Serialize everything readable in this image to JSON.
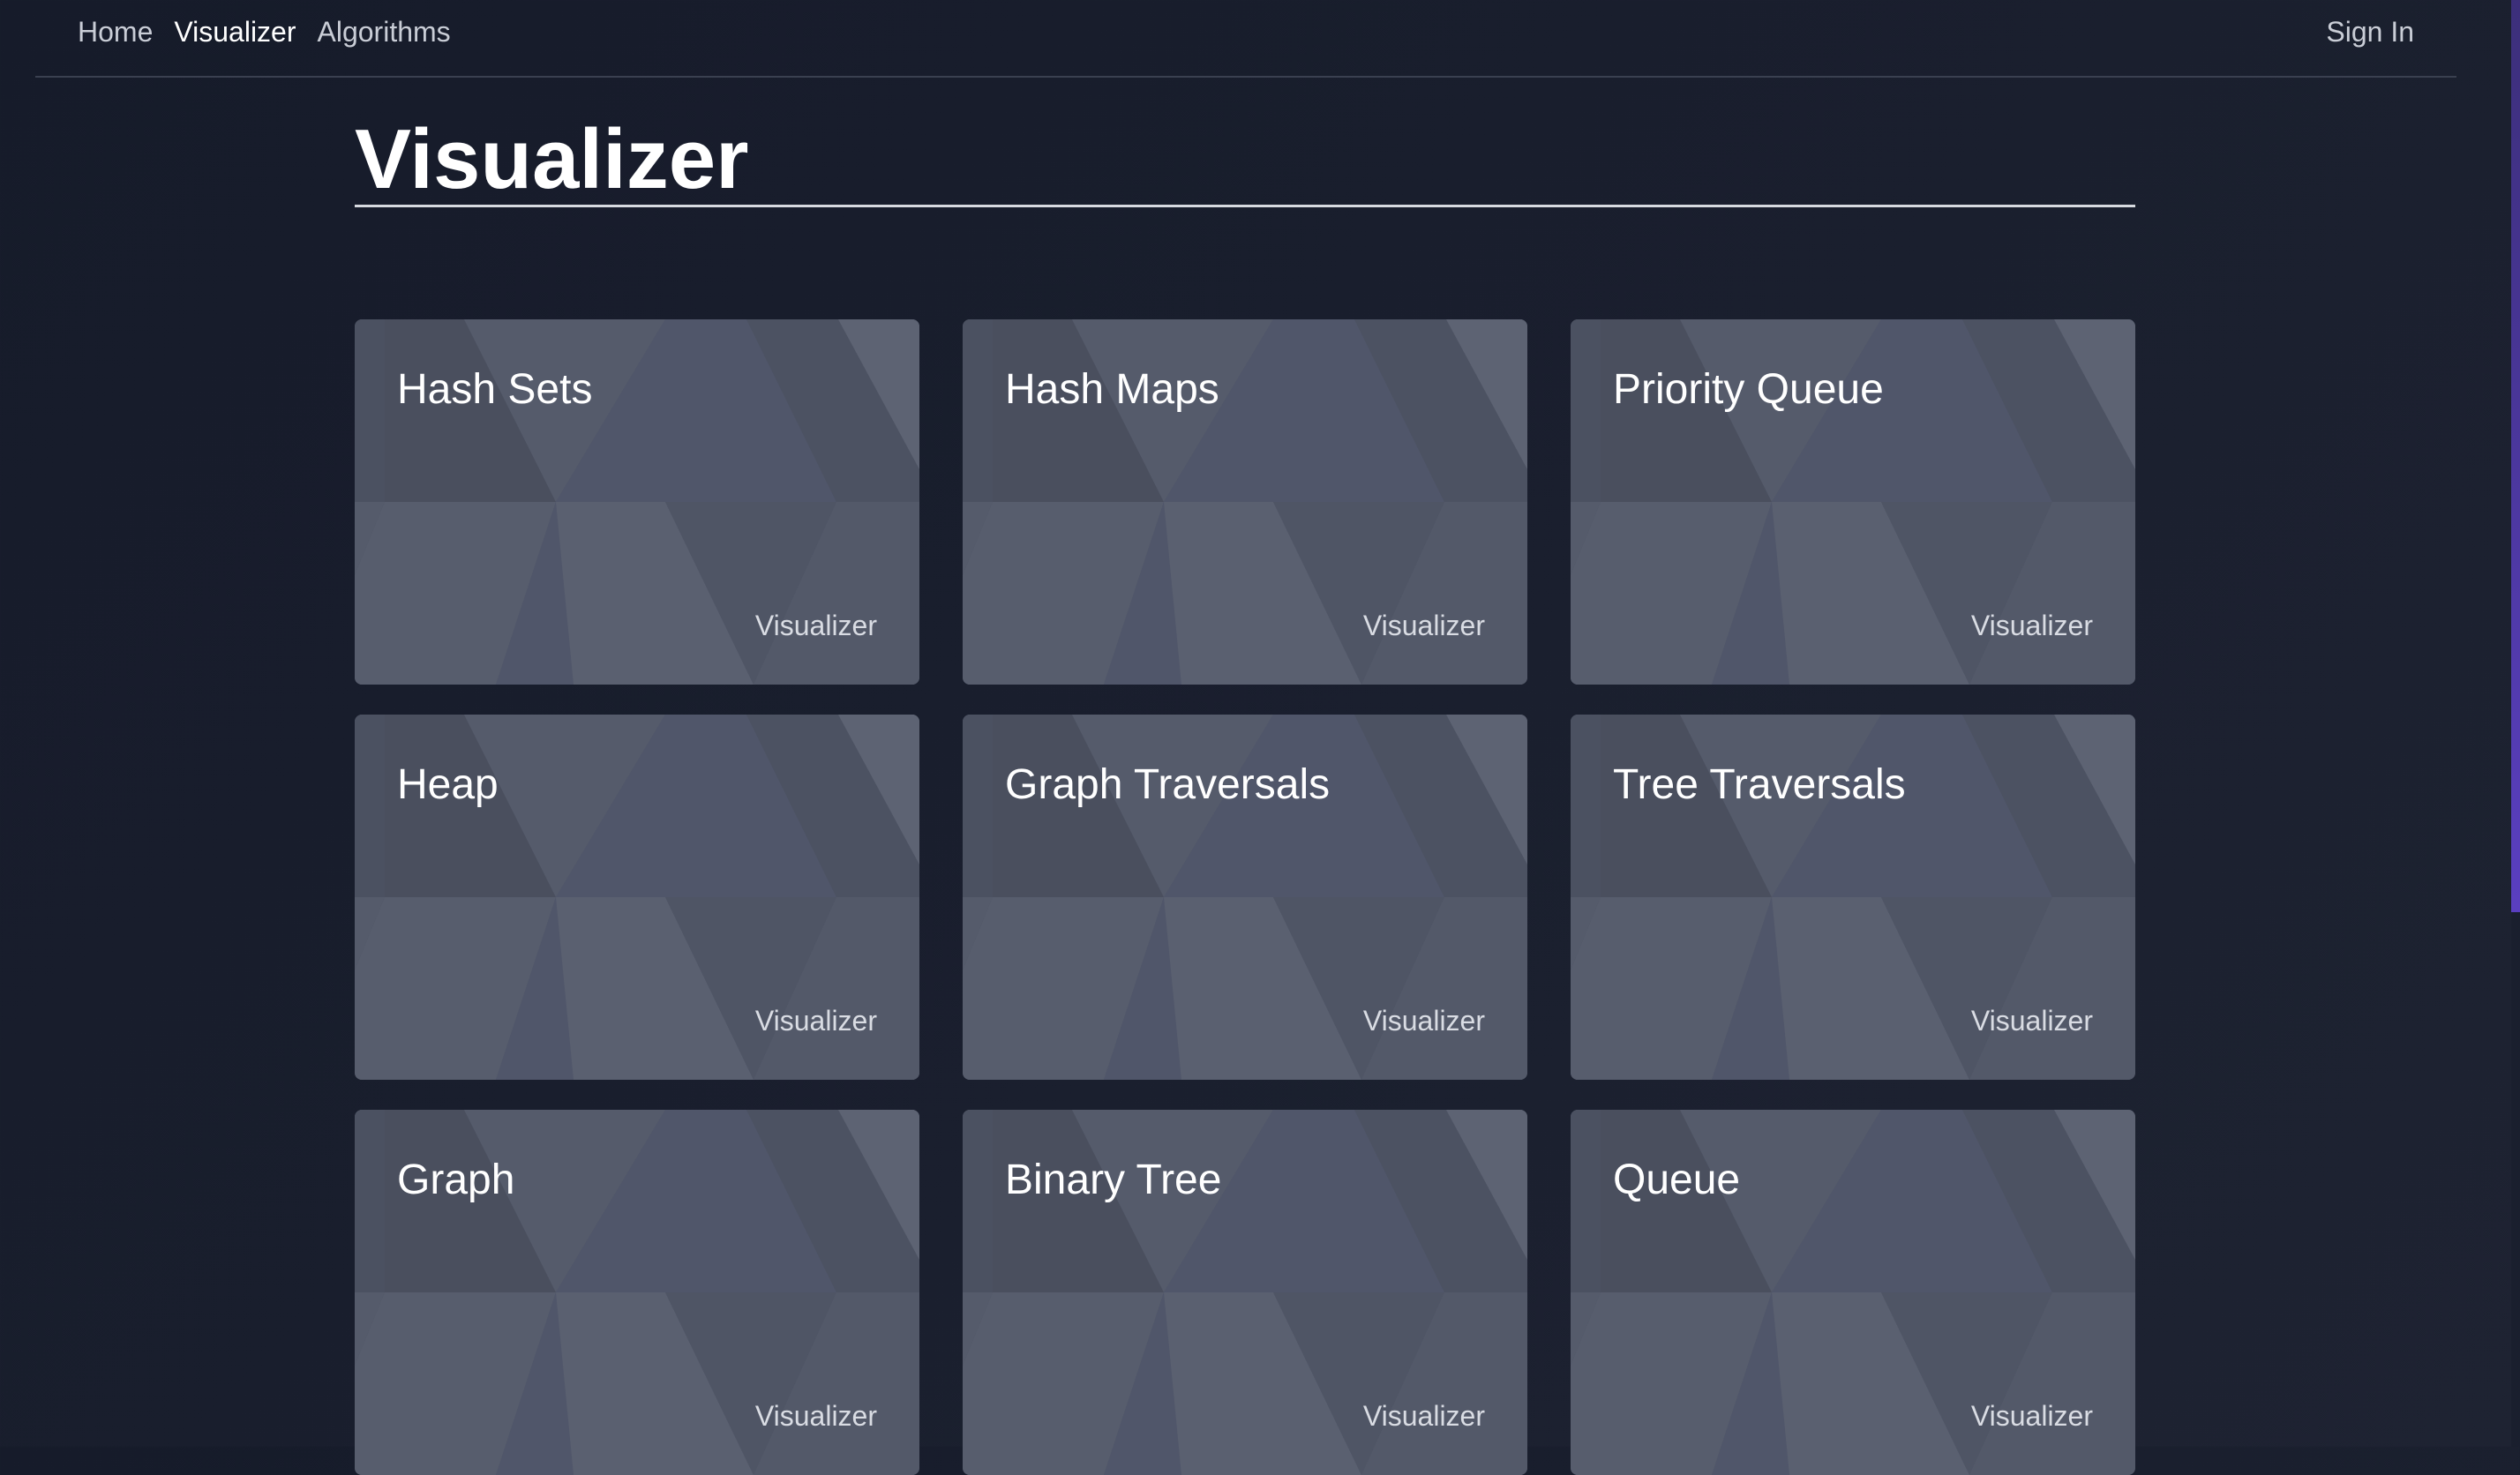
{
  "nav": {
    "links": [
      "Home",
      "Visualizer",
      "Algorithms"
    ],
    "sign_in": "Sign In"
  },
  "page": {
    "title": "Visualizer"
  },
  "cards": [
    {
      "title": "Hash Sets",
      "subtitle": "Visualizer"
    },
    {
      "title": "Hash Maps",
      "subtitle": "Visualizer"
    },
    {
      "title": "Priority Queue",
      "subtitle": "Visualizer"
    },
    {
      "title": "Heap",
      "subtitle": "Visualizer"
    },
    {
      "title": "Graph Traversals",
      "subtitle": "Visualizer"
    },
    {
      "title": "Tree Traversals",
      "subtitle": "Visualizer"
    },
    {
      "title": "Graph",
      "subtitle": "Visualizer"
    },
    {
      "title": "Binary Tree",
      "subtitle": "Visualizer"
    },
    {
      "title": "Queue",
      "subtitle": "Visualizer"
    }
  ],
  "colors": {
    "background": "#181d2b",
    "card": "#4f5566",
    "scrollbar": "#5a3fc0"
  }
}
